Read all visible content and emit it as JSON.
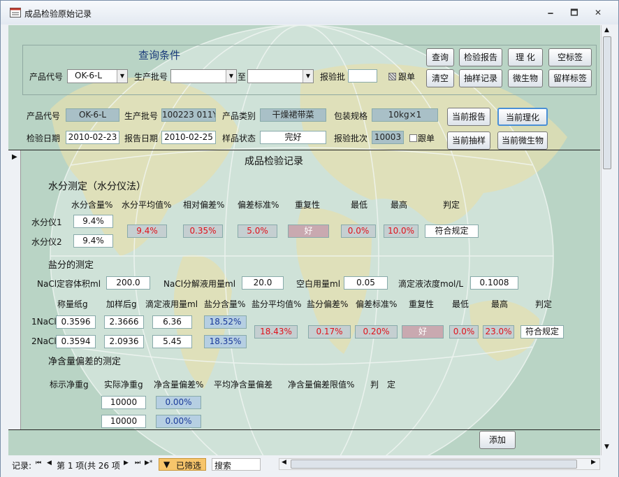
{
  "window": {
    "title": "成品检验原始记录",
    "min": "🗕",
    "max": "🗖",
    "close": "✕"
  },
  "query": {
    "heading": "查询条件",
    "product_code_label": "产品代号",
    "product_code_value": "OK-6-L",
    "batch_label": "生产批号",
    "batch_to": "至",
    "inspect_batch_label": "报验批",
    "sample_label": "跟单",
    "buttons": {
      "query": "查询",
      "report": "检验报告",
      "physchem": "理 化",
      "blank_label": "空标签",
      "clear": "清空",
      "sampling": "抽样记录",
      "micro": "微生物",
      "retain_label": "留样标签"
    }
  },
  "info": {
    "product_code_label": "产品代号",
    "product_code": "OK-6-L",
    "batch_label": "生产批号",
    "batch": "100223 011Y",
    "category_label": "产品类别",
    "category": "干燥裙带菜",
    "pack_label": "包装规格",
    "pack": "10kg×1",
    "inspect_date_label": "检验日期",
    "inspect_date": "2010-02-23",
    "report_date_label": "报告日期",
    "report_date": "2010-02-25",
    "state_label": "样品状态",
    "state": "完好",
    "inspect_no_label": "报验批次",
    "inspect_no": "10003",
    "follow_label": "跟单",
    "buttons": {
      "cur_report": "当前报告",
      "cur_physchem": "当前理化",
      "cur_sampling": "当前抽样",
      "cur_micro": "当前微生物"
    }
  },
  "record": {
    "heading": "成品检验记录",
    "moisture": {
      "heading": "水分测定（水分仪法）",
      "cols": [
        "水分含量%",
        "水分平均值%",
        "相对偏差%",
        "偏差标准%",
        "重复性",
        "最低",
        "最高",
        "判定"
      ],
      "rows": [
        {
          "label": "水分仪1",
          "value": "9.4%"
        },
        {
          "label": "水分仪2",
          "value": "9.4%"
        }
      ],
      "avg": "9.4%",
      "rel_dev": "0.35%",
      "std": "5.0%",
      "repeat": "好",
      "min": "0.0%",
      "max": "10.0%",
      "verdict": "符合规定"
    },
    "salt": {
      "heading": "盐分的测定",
      "vol_label": "NaCl定容体积ml",
      "vol": "200.0",
      "dec_label": "NaCl分解液用量ml",
      "dec": "20.0",
      "blank_label": "空白用量ml",
      "blank": "0.05",
      "conc_label": "滴定液浓度mol/L",
      "conc": "0.1008",
      "cols": [
        "称量纸g",
        "加样后g",
        "滴定液用量ml",
        "盐分含量%",
        "盐分平均值%",
        "盐分偏差%",
        "偏差标准%",
        "重复性",
        "最低",
        "最高",
        "判定"
      ],
      "rows": [
        {
          "label": "1NaCl",
          "paper": "0.3596",
          "after": "2.3666",
          "titr": "6.36",
          "content": "18.52%"
        },
        {
          "label": "2NaCl",
          "paper": "0.3594",
          "after": "2.0936",
          "titr": "5.45",
          "content": "18.35%"
        }
      ],
      "avg": "18.43%",
      "dev": "0.17%",
      "std": "0.20%",
      "repeat": "好",
      "min": "0.0%",
      "max": "23.0%",
      "verdict": "符合规定"
    },
    "net": {
      "heading": "净含量偏差的测定",
      "cols": [
        "标示净重g",
        "实际净重g",
        "净含量偏差%",
        "平均净含量偏差",
        "净含量偏差限值%",
        "判　定"
      ],
      "rows": [
        {
          "actual": "10000",
          "dev": "0.00%"
        },
        {
          "actual": "10000",
          "dev": "0.00%"
        }
      ]
    },
    "add_button": "添加"
  },
  "status": {
    "record_label": "记录:",
    "first": "⏮",
    "prev": "◀",
    "position": "第 1 项(共 26 项",
    "next": "▶",
    "last": "⏭",
    "new": "▶*",
    "filter": "已筛选",
    "search": "搜索"
  }
}
